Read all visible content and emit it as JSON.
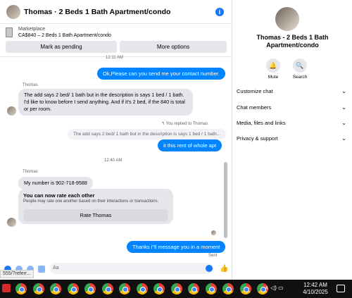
{
  "header": {
    "title": "Thomas · 2 Beds 1 Bath Apartment/condo",
    "info_icon": "info-icon"
  },
  "marketplace": {
    "label": "Marketplace",
    "listing": "CA$840 – 2 Beds 1 Bath Apartment/condo",
    "mark_pending": "Mark as pending",
    "more_options": "More options"
  },
  "messages": {
    "stamp1": "12:11 AM",
    "out1": "Ok,Please can you send me your contact number.",
    "sender1": "Thomas",
    "in1": "The add says 2 bed/ 1 bath but in the description is says 1 bed / 1 bath. I'd like to know before I send anything. And if it's 2 bed, if the 840 is total or per room.",
    "reply_note": "You replied to Thomas",
    "reply_quote": "The add says 2 bed/ 1 bath but in the description is says 1 bed / 1 bath...",
    "out2": "it this rent of whole apt",
    "stamp2": "12:40 AM",
    "sender2": "Thomas",
    "in2": "My number is 902-718-9588",
    "rate_title": "You can now rate each other",
    "rate_sub": "People may rate one another based on their interactions or transactions.",
    "rate_button": "Rate Thomas",
    "out3": "Thanks i\"ll message you in a moment",
    "sent": "Sent"
  },
  "composer": {
    "placeholder": "Aa"
  },
  "status_url": "555/?referr...",
  "info": {
    "title": "Thomas - 2 Beds 1 Bath Apartment/condo",
    "mute": "Mute",
    "search": "Search",
    "rows": [
      "Customize chat",
      "Chat members",
      "Media, files and links",
      "Privacy & support"
    ]
  },
  "taskbar": {
    "time": "12:42 AM",
    "date": "4/10/2025",
    "app_icon": "chrome-icon",
    "app_count": 15
  },
  "colors": {
    "accent": "#0084ff",
    "bubble_in": "#e4e6eb",
    "taskbar": "#101010"
  }
}
